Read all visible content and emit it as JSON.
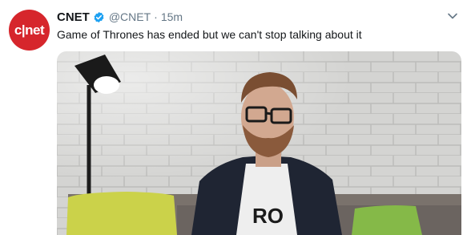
{
  "tweet": {
    "avatar_text": "c|net",
    "display_name": "CNET",
    "handle": "@CNET",
    "separator": "·",
    "time": "15m",
    "text": "Game of Thrones has ended but we can't stop talking about it",
    "verified": true,
    "colors": {
      "avatar_bg": "#d6262c",
      "verified": "#1da1f2",
      "secondary_text": "#657786",
      "primary_text": "#14171a"
    },
    "media": {
      "type": "video",
      "shirt_text": "RO"
    }
  }
}
